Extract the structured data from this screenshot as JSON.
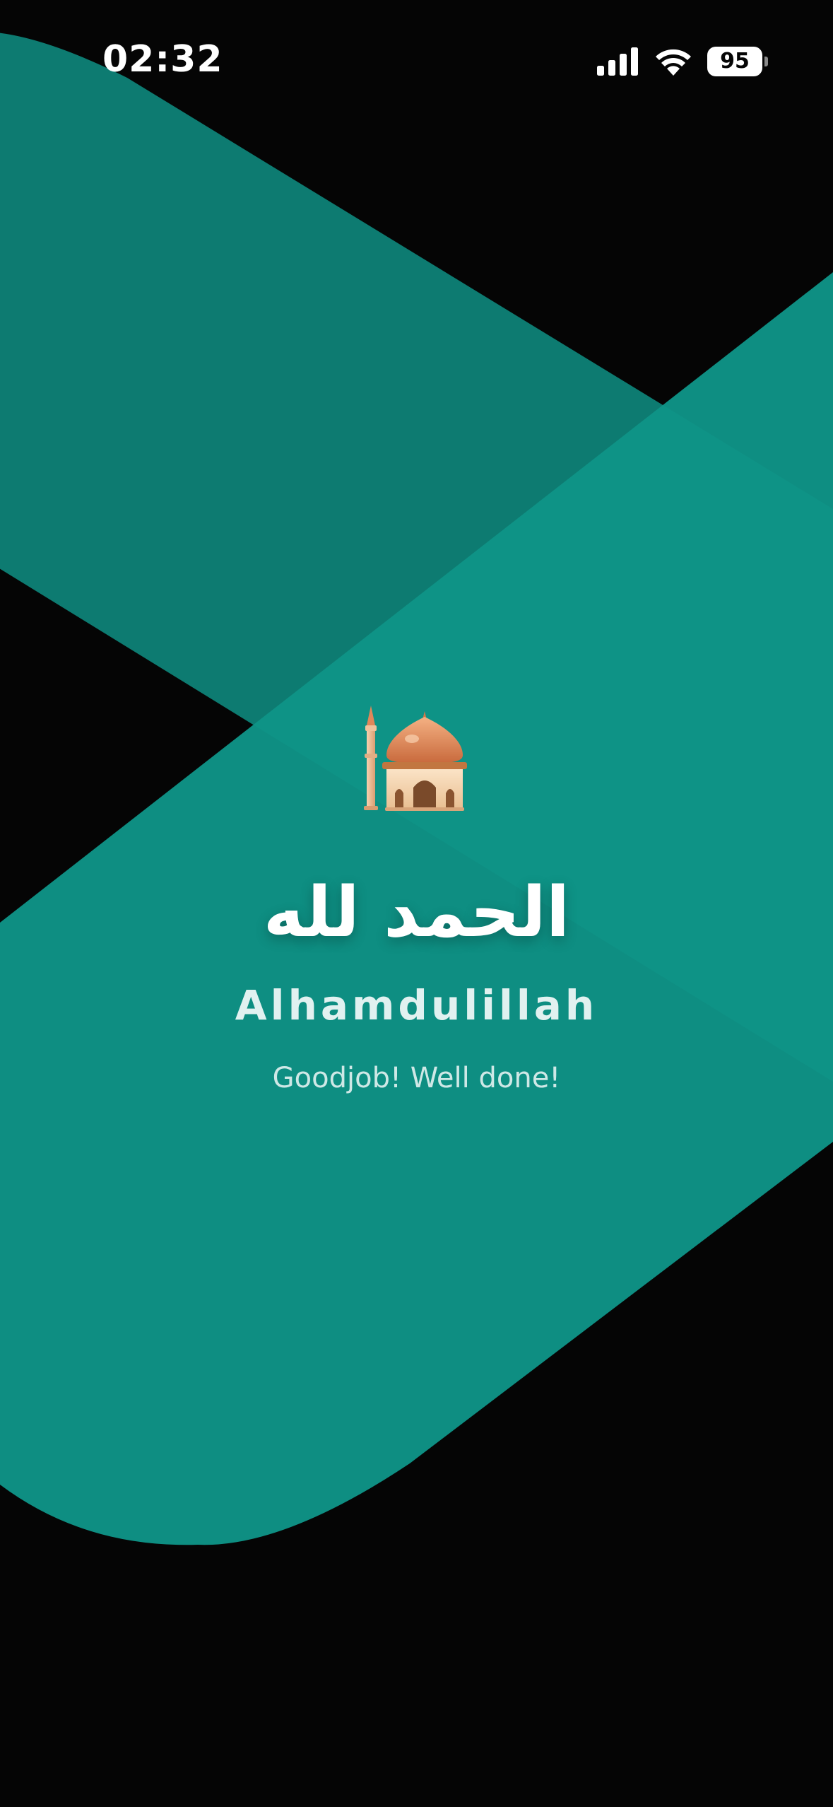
{
  "status_bar": {
    "time": "02:32",
    "battery_level": "95",
    "icons": [
      "signal-icon",
      "wifi-icon",
      "battery-icon"
    ]
  },
  "completion": {
    "icon": "mosque-icon",
    "arabic_text": "الحمد لله",
    "transliteration": "Alhamdulillah",
    "message": "Goodjob! Well done!"
  },
  "colors": {
    "background": "#050505",
    "teal_dark": "#0D7B71",
    "teal": "#0F9487",
    "text": "#FFFFFF"
  }
}
